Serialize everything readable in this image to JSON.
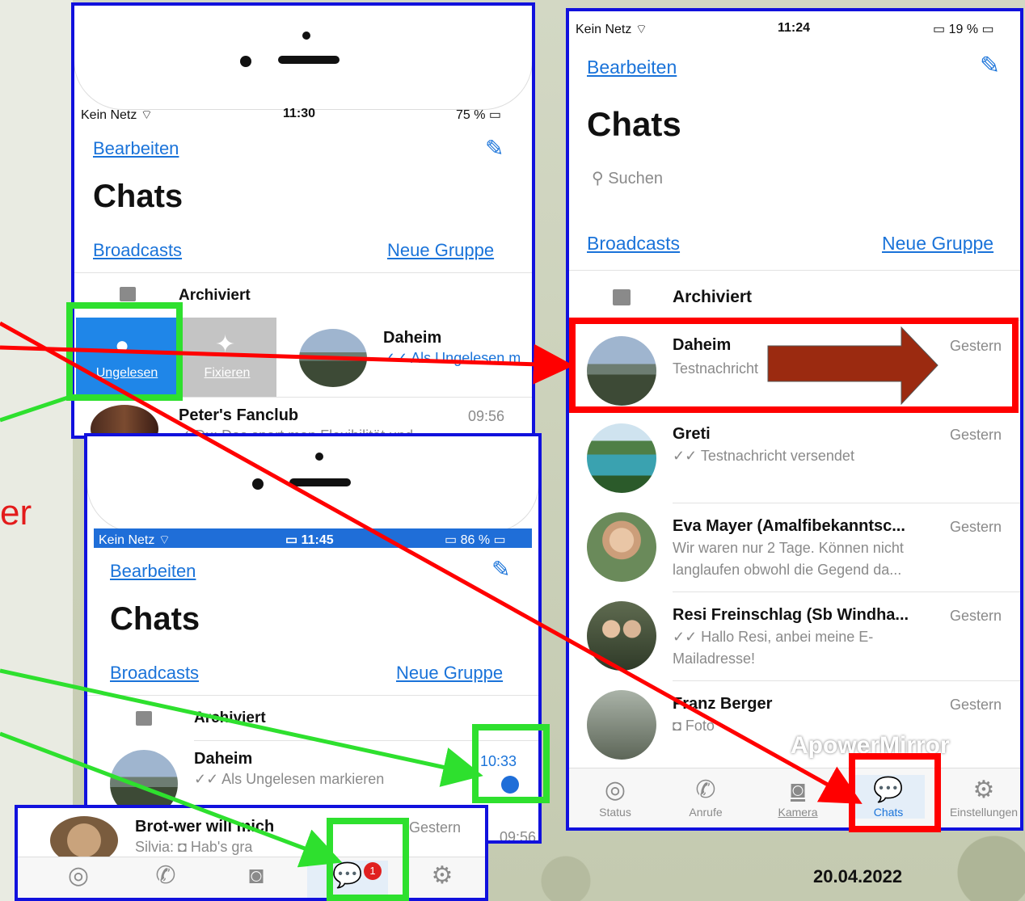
{
  "side_text": "er",
  "date": "20.04.2022",
  "watermark": "ApowerMirror",
  "phoneA": {
    "carrier": "Kein Netz",
    "time": "11:30",
    "battery": "75 %",
    "edit": "Bearbeiten",
    "title": "Chats",
    "broadcasts": "Broadcasts",
    "new_group": "Neue Gruppe",
    "archived": "Archiviert",
    "swipe_unread": "Ungelesen",
    "swipe_pin": "Fixieren",
    "chat1": {
      "name": "Daheim",
      "msg": "✓✓ Als Ungelesen m"
    },
    "chat2": {
      "name": "Peter's Fanclub",
      "time": "09:56",
      "msg": "✓ Du: Das spart man Flexibilität und"
    }
  },
  "phoneB": {
    "carrier": "Kein Netz",
    "time": "11:45",
    "battery": "86 %",
    "edit": "Bearbeiten",
    "title": "Chats",
    "broadcasts": "Broadcasts",
    "new_group": "Neue Gruppe",
    "archived": "Archiviert",
    "chat1": {
      "name": "Daheim",
      "time": "10:33",
      "msg": "✓✓ Als Ungelesen markieren"
    },
    "chat2": {
      "name": "Brot-wer will mich",
      "time": "Gestern",
      "msg": "Silvia: ◘ Hab's gra"
    },
    "side_time": "09:56",
    "tabs": [
      "Status",
      "Anrufe",
      "Kamera",
      "Chats",
      "Einstellungen"
    ],
    "badge": "1"
  },
  "phoneC": {
    "carrier": "Kein Netz",
    "time": "11:24",
    "battery": "19 %",
    "edit": "Bearbeiten",
    "title": "Chats",
    "search": "Suchen",
    "broadcasts": "Broadcasts",
    "new_group": "Neue Gruppe",
    "archived": "Archiviert",
    "chats": [
      {
        "name": "Daheim",
        "time": "Gestern",
        "msg": "Testnachricht",
        "msg2": ""
      },
      {
        "name": "Greti",
        "time": "Gestern",
        "msg": "✓✓ Testnachricht versendet",
        "msg2": ""
      },
      {
        "name": "Eva Mayer (Amalfibekanntsc...",
        "time": "Gestern",
        "msg": "Wir waren nur 2 Tage. Können nicht",
        "msg2": "langlaufen obwohl die Gegend da..."
      },
      {
        "name": "Resi Freinschlag (Sb Windha...",
        "time": "Gestern",
        "msg": "✓✓ Hallo Resi, anbei meine E-",
        "msg2": "Mailadresse!"
      },
      {
        "name": "Franz Berger",
        "time": "Gestern",
        "msg": "◘ Foto",
        "msg2": ""
      }
    ],
    "tabs": [
      "Status",
      "Anrufe",
      "Kamera",
      "Chats",
      "Einstellungen"
    ]
  },
  "colors": {
    "accent": "#1a73d9",
    "annotation_red": "#ff0000",
    "annotation_green": "#2ee02e",
    "frame_blue": "#1111dd",
    "arrow_brown": "#9b2a10"
  }
}
